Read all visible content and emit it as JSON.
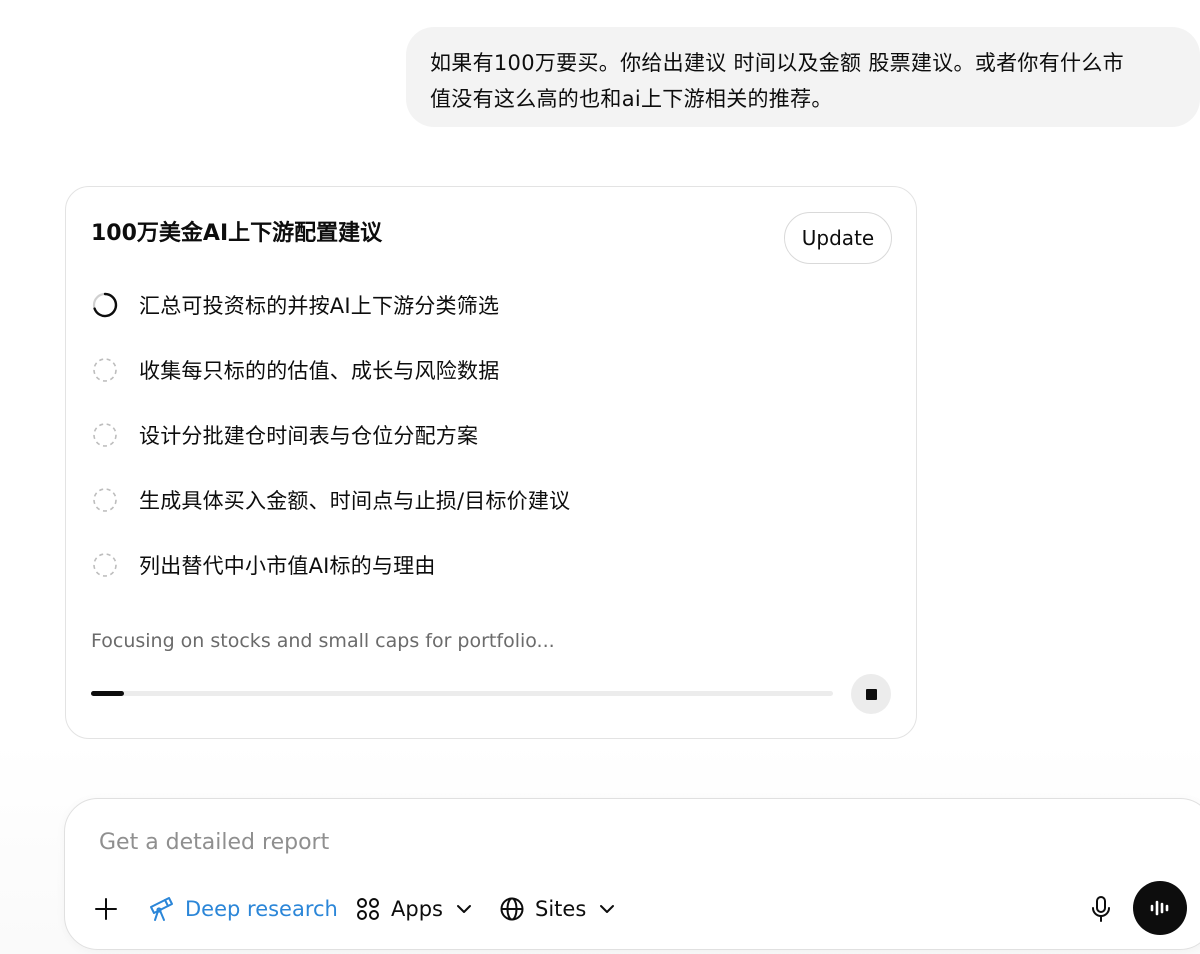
{
  "user_message": {
    "line1": "如果有100万要买。你给出建议 时间以及金额 股票建议。或者你有什么市",
    "line2": "值没有这么高的也和ai上下游相关的推荐。"
  },
  "research_card": {
    "title": "100万美金AI上下游配置建议",
    "update_label": "Update",
    "steps": [
      {
        "label": "汇总可投资标的并按AI上下游分类筛选",
        "state": "in-progress"
      },
      {
        "label": "收集每只标的的估值、成长与风险数据",
        "state": "pending"
      },
      {
        "label": "设计分批建仓时间表与仓位分配方案",
        "state": "pending"
      },
      {
        "label": "生成具体买入金额、时间点与止损/目标价建议",
        "state": "pending"
      },
      {
        "label": "列出替代中小市值AI标的与理由",
        "state": "pending"
      }
    ],
    "status_text": "Focusing on stocks and small caps for portfolio...",
    "progress_percent": 4.5
  },
  "composer": {
    "placeholder": "Get a detailed report",
    "tools": {
      "deep_research": "Deep research",
      "apps": "Apps",
      "sites": "Sites"
    }
  },
  "colors": {
    "accent_blue": "#2b86d8",
    "bubble_bg": "#f3f3f3",
    "text": "#0d0d0d"
  }
}
